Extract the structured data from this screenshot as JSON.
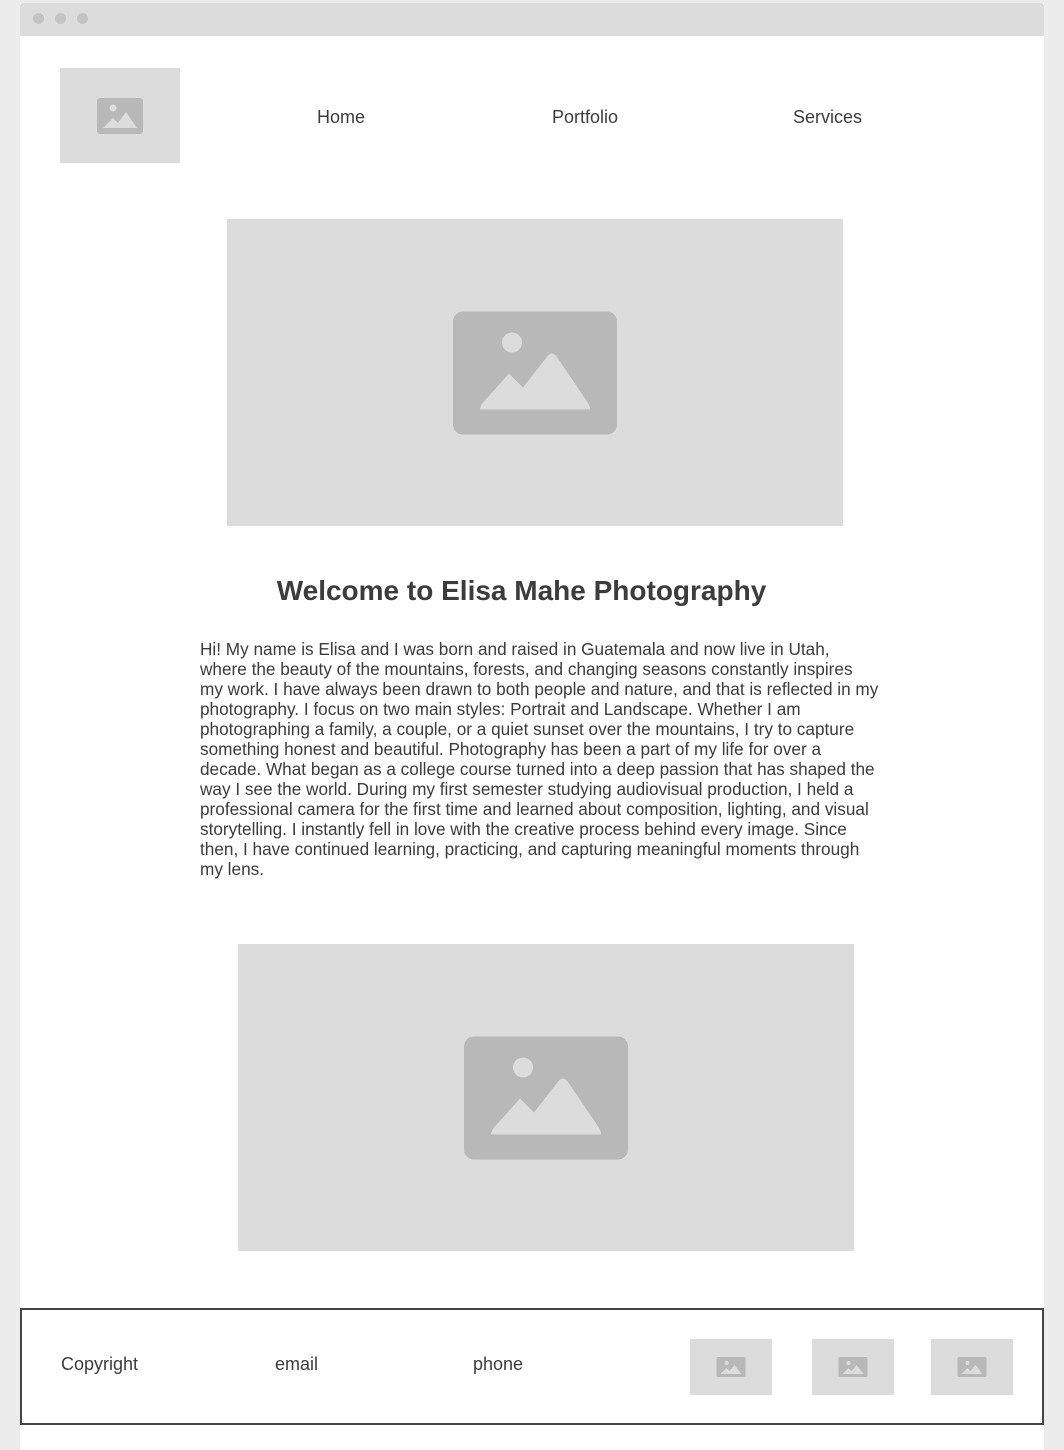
{
  "nav": {
    "links": [
      {
        "label": "Home"
      },
      {
        "label": "Portfolio"
      },
      {
        "label": "Services"
      }
    ]
  },
  "main": {
    "title": "Welcome to Elisa Mahe Photography",
    "intro": "Hi! My name is Elisa and I was born and raised in Guatemala and now live in Utah, where the beauty of the mountains, forests, and changing seasons constantly inspires my work. I have always been drawn to both people and nature, and that is reflected in my photography. I focus on two main styles: Portrait and Landscape. Whether I am photographing a family, a couple, or a quiet sunset over the mountains, I try to capture something honest and beautiful. Photography has been a part of my life for over a decade. What began as a college course turned into a deep passion that has shaped the way I see the world. During my first semester studying audiovisual production, I held a professional camera for the first time and learned about composition, lighting, and visual storytelling. I instantly fell in love with the creative process behind every image. Since then, I have continued learning, practicing, and capturing meaningful moments through my lens."
  },
  "footer": {
    "copyright": "Copyright",
    "email": "email",
    "phone": "phone"
  },
  "icons": {
    "placeholder": "image-placeholder-icon"
  },
  "colors": {
    "placeholder_bg": "#dcdcdc",
    "placeholder_icon": "#b8b8b8",
    "text": "#3c3c3c",
    "border": "#444444"
  }
}
